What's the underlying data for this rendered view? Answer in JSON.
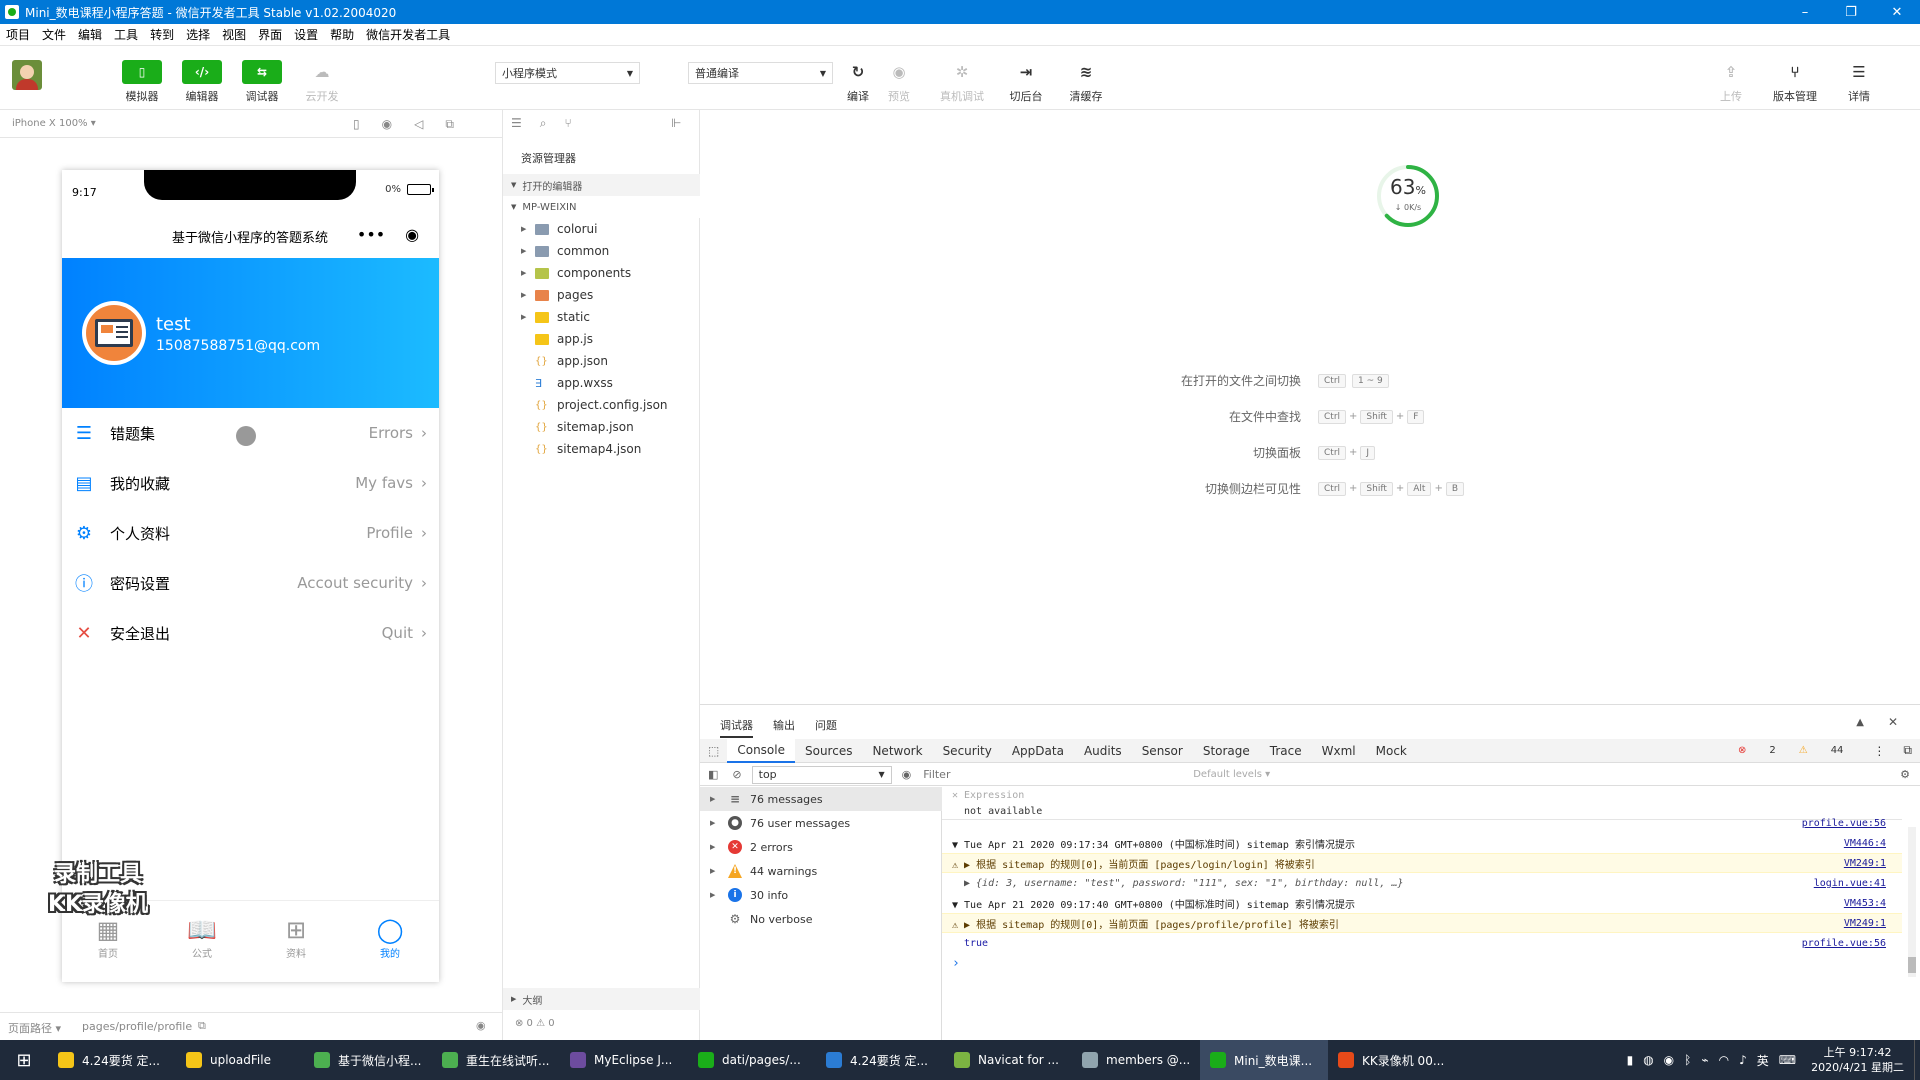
{
  "window": {
    "title": "Mini_数电课程小程序答题 - 微信开发者工具 Stable v1.02.2004020",
    "controls": [
      "–",
      "❐",
      "✕"
    ]
  },
  "menu": [
    "项目",
    "文件",
    "编辑",
    "工具",
    "转到",
    "选择",
    "视图",
    "界面",
    "设置",
    "帮助",
    "微信开发者工具"
  ],
  "toolbar": {
    "simulator": "模拟器",
    "editor": "编辑器",
    "debugger": "调试器",
    "cloud": "云开发",
    "mode": "小程序模式",
    "compile_mode": "普通编译",
    "compile": "编译",
    "preview": "预览",
    "remote_debug": "真机调试",
    "background": "切后台",
    "clear_cache": "清缓存",
    "upload": "上传",
    "version": "版本管理",
    "details": "详情"
  },
  "simulator": {
    "device": "iPhone X 100% ▾",
    "time": "9:17",
    "battery": "0%",
    "nav_title": "基于微信小程序的答题系统",
    "user_name": "test",
    "user_email": "15087588751@qq.com",
    "menu": [
      {
        "label": "错题集",
        "right": "Errors",
        "icon": "☰",
        "color": "#0081ff"
      },
      {
        "label": "我的收藏",
        "right": "My favs",
        "icon": "▤",
        "color": "#0081ff"
      },
      {
        "label": "个人资料",
        "right": "Profile",
        "icon": "⚙",
        "color": "#0081ff"
      },
      {
        "label": "密码设置",
        "right": "Accout security",
        "icon": "ⓘ",
        "color": "#0081ff"
      },
      {
        "label": "安全退出",
        "right": "Quit",
        "icon": "✕",
        "color": "#e54d42"
      }
    ],
    "chevron": "›",
    "tabs": [
      {
        "label": "首页",
        "icon": "▦"
      },
      {
        "label": "公式",
        "icon": "📖"
      },
      {
        "label": "资料",
        "icon": "⊞"
      },
      {
        "label": "我的",
        "icon": "◯"
      }
    ],
    "watermark_line1": "录制工具",
    "watermark_line2": "KK录像机",
    "footer_path_label": "页面路径 ▾",
    "footer_path": "pages/profile/profile",
    "footer_status": "⊗ 0 ⚠ 0"
  },
  "explorer": {
    "title": "资源管理器",
    "open_editors": "打开的编辑器",
    "project": "MP-WEIXIN",
    "outline": "大纲",
    "files": [
      {
        "name": "colorui",
        "type": "folder",
        "color": "#8a9bb0"
      },
      {
        "name": "common",
        "type": "folder",
        "color": "#8a9bb0"
      },
      {
        "name": "components",
        "type": "folder",
        "color": "#b5c44a"
      },
      {
        "name": "pages",
        "type": "folder",
        "color": "#e8834a"
      },
      {
        "name": "static",
        "type": "folder",
        "color": "#f5c518"
      },
      {
        "name": "app.js",
        "type": "js"
      },
      {
        "name": "app.json",
        "type": "json"
      },
      {
        "name": "app.wxss",
        "type": "css"
      },
      {
        "name": "project.config.json",
        "type": "json"
      },
      {
        "name": "sitemap.json",
        "type": "json"
      },
      {
        "name": "sitemap4.json",
        "type": "json"
      }
    ]
  },
  "editor": {
    "progress_percent": 63,
    "progress_unit": "%",
    "speed": "↓ 0K/s",
    "shortcuts": [
      {
        "label": "在打开的文件之间切换",
        "keys": [
          "Ctrl",
          "1 ~ 9"
        ]
      },
      {
        "label": "在文件中查找",
        "keys": [
          "Ctrl",
          "+",
          "Shift",
          "+",
          "F"
        ]
      },
      {
        "label": "切换面板",
        "keys": [
          "Ctrl",
          "+",
          "J"
        ]
      },
      {
        "label": "切换侧边栏可见性",
        "keys": [
          "Ctrl",
          "+",
          "Shift",
          "+",
          "Alt",
          "+",
          "B"
        ]
      }
    ]
  },
  "devtools": {
    "top_tabs": [
      "调试器",
      "输出",
      "问题"
    ],
    "tabs": [
      "Console",
      "Sources",
      "Network",
      "Security",
      "AppData",
      "Audits",
      "Sensor",
      "Storage",
      "Trace",
      "Wxml",
      "Mock"
    ],
    "errors": "2",
    "warnings": "44",
    "context": "top",
    "filter_placeholder": "Filter",
    "levels": "Default levels ▾",
    "sidebar": [
      {
        "label": "76 messages",
        "icon": "≡",
        "color": "#666"
      },
      {
        "label": "76 user messages",
        "icon": "●",
        "color": "#555"
      },
      {
        "label": "2 errors",
        "icon": "✕",
        "color": "#e53935"
      },
      {
        "label": "44 warnings",
        "icon": "!",
        "color": "#f5a623"
      },
      {
        "label": "30 info",
        "icon": "i",
        "color": "#1a73e8"
      },
      {
        "label": "No verbose",
        "icon": "⚙",
        "color": "#666"
      }
    ],
    "expression_label": "Expression",
    "expression_value": "not available",
    "lines": [
      {
        "text": "profile.vue:56",
        "src": "",
        "kind": "src-only"
      },
      {
        "text": "▼ Tue Apr 21 2020 09:17:34 GMT+0800 (中国标准时间) sitemap 索引情况提示",
        "src": "VM446:4",
        "kind": "normal"
      },
      {
        "text": "⚠ ▶ 根据 sitemap 的规则[0]，当前页面 [pages/login/login] 将被索引",
        "src": "VM249:1",
        "kind": "warn"
      },
      {
        "text": "▶ {id: 3, username: \"test\", password: \"111\", sex: \"1\", birthday: null, …}",
        "src": "login.vue:41",
        "kind": "obj"
      },
      {
        "text": "▼ Tue Apr 21 2020 09:17:40 GMT+0800 (中国标准时间) sitemap 索引情况提示",
        "src": "VM453:4",
        "kind": "normal"
      },
      {
        "text": "⚠ ▶ 根据 sitemap 的规则[0]，当前页面 [pages/profile/profile] 将被索引",
        "src": "VM249:1",
        "kind": "warn"
      },
      {
        "text": "true",
        "src": "profile.vue:56",
        "kind": "bool"
      },
      {
        "text": "›",
        "src": "",
        "kind": "prompt"
      }
    ]
  },
  "taskbar": {
    "items": [
      {
        "label": "4.24要货 定...",
        "color": "#f5c518"
      },
      {
        "label": "uploadFile",
        "color": "#f5c518"
      },
      {
        "label": "基于微信小程...",
        "color": "#4caf50"
      },
      {
        "label": "重生在线试听...",
        "color": "#4caf50"
      },
      {
        "label": "MyEclipse J...",
        "color": "#6d4c9f"
      },
      {
        "label": "dati/pages/...",
        "color": "#1aad19"
      },
      {
        "label": "4.24要货 定...",
        "color": "#2b7cd3"
      },
      {
        "label": "Navicat for ...",
        "color": "#7cb342"
      },
      {
        "label": "members @...",
        "color": "#90a4ae"
      },
      {
        "label": "Mini_数电课...",
        "color": "#1aad19"
      },
      {
        "label": "KK录像机 00...",
        "color": "#e64a19"
      }
    ],
    "ime": "英",
    "time": "上午 9:17:42",
    "date": "2020/4/21 星期二"
  }
}
